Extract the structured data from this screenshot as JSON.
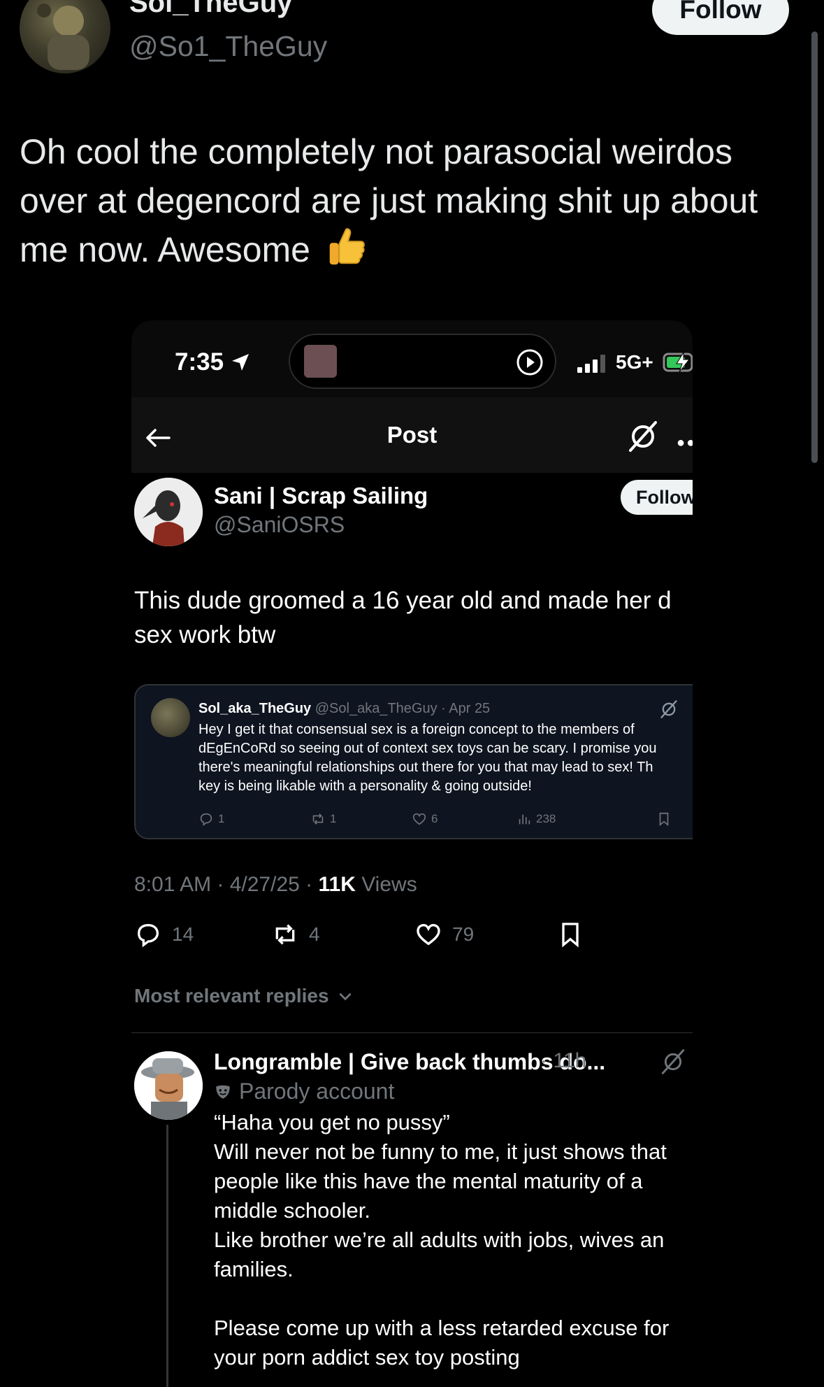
{
  "outer_post": {
    "display_name": "Sol_TheGuy",
    "handle": "@So1_TheGuy",
    "follow_label": "Follow",
    "text": "Oh cool the completely not parasocial weirdos over at degencord are just making shit up about me now. Awesome",
    "emoji": "thumbs-up"
  },
  "screenshot": {
    "status_bar": {
      "time": "7:35",
      "network": "5G+"
    },
    "nav": {
      "title": "Post"
    },
    "post": {
      "display_name": "Sani | Scrap Sailing",
      "handle": "@SaniOSRS",
      "follow_label": "Follow",
      "text_line1": "This dude groomed a 16 year old and made her d",
      "text_line2": "sex work btw",
      "timestamp": "8:01 AM · 4/27/25 · ",
      "views_count": "11K",
      "views_label": " Views",
      "replies": "14",
      "reposts": "4",
      "likes": "79"
    },
    "quote": {
      "display_name": "Sol_aka_TheGuy",
      "handle_date": " @Sol_aka_TheGuy · Apr 25",
      "line1": "Hey I get it that consensual sex is a foreign concept to the members of",
      "line2": "dEgEnCoRd so seeing out of context sex toys can be scary. I promise you",
      "line3": "there's meaningful relationships out there for you that may lead to sex! Th",
      "line4": "key is being likable with a personality & going outside!",
      "replies": "1",
      "reposts": "1",
      "likes": "6",
      "views": "238"
    },
    "replies_filter": "Most relevant replies",
    "reply": {
      "display_name": "Longramble | Give back thumbs do...",
      "time": "· 11h",
      "badge": "Parody account",
      "text": "“Haha you get no pussy”\nWill never not be funny to me, it just shows that\npeople like this have the mental maturity of a\nmiddle schooler.\nLike brother we’re all adults with jobs, wives an\nfamilies.\n\nPlease come up with a less retarded excuse for\nyour porn addict sex toy posting"
    }
  },
  "colors": {
    "background": "#000000",
    "text_primary": "#e7e9ea",
    "text_secondary": "#71767b",
    "follow_bg": "#eff3f4",
    "quote_bg": "#0e1420"
  }
}
